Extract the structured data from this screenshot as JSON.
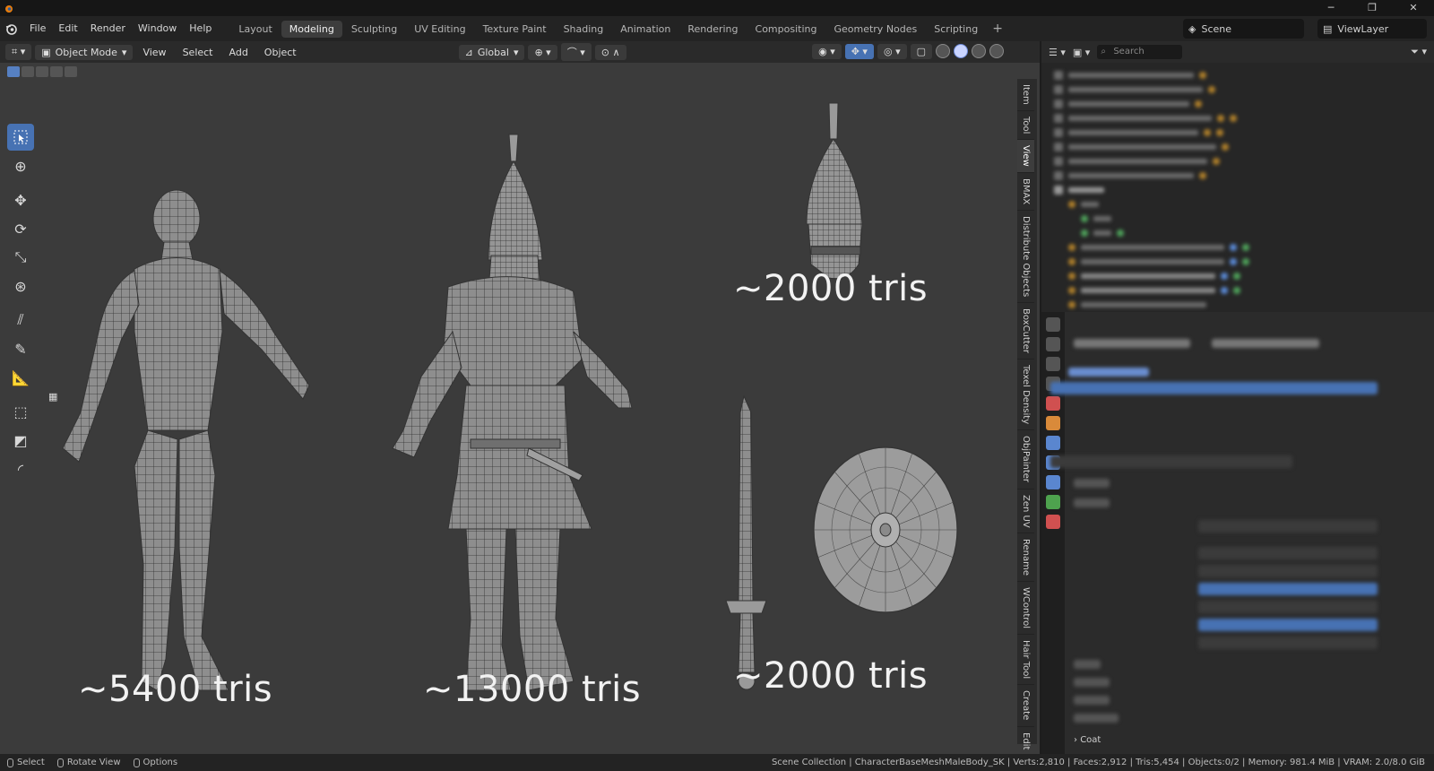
{
  "menu": [
    "File",
    "Edit",
    "Render",
    "Window",
    "Help"
  ],
  "workspaces": [
    "Layout",
    "Modeling",
    "Sculpting",
    "UV Editing",
    "Texture Paint",
    "Shading",
    "Animation",
    "Rendering",
    "Compositing",
    "Geometry Nodes",
    "Scripting"
  ],
  "active_workspace": "Modeling",
  "scene": "Scene",
  "view_layer": "ViewLayer",
  "viewport_header": {
    "mode": "Object Mode",
    "menus": [
      "View",
      "Select",
      "Add",
      "Object"
    ],
    "transform_orientation": "Global"
  },
  "labels": {
    "body": "~5400 tris",
    "armored": "~13000 tris",
    "helmet": "~2000 tris",
    "weapons": "~2000 tris"
  },
  "n_panel_tabs": [
    "Item",
    "Tool",
    "View",
    "BMAX",
    "Distribute Objects",
    "BoxCutter",
    "Texel Density",
    "ObjPainter",
    "Zen UV",
    "Rename",
    "WControl",
    "Hair Tool",
    "Create",
    "Edit"
  ],
  "outliner": {
    "search_placeholder": "Search"
  },
  "properties": {
    "last_visible": "Coat"
  },
  "status": {
    "select": "Select",
    "rotate": "Rotate View",
    "options": "Options",
    "info": "Scene Collection | CharacterBaseMeshMaleBody_SK | Verts:2,810 | Faces:2,912 | Tris:5,454 | Objects:0/2 | Memory: 981.4 MiB | VRAM: 2.0/8.0 GiB"
  },
  "colors": {
    "accent": "#4772b3",
    "viewport_bg": "#3b3b3b"
  }
}
